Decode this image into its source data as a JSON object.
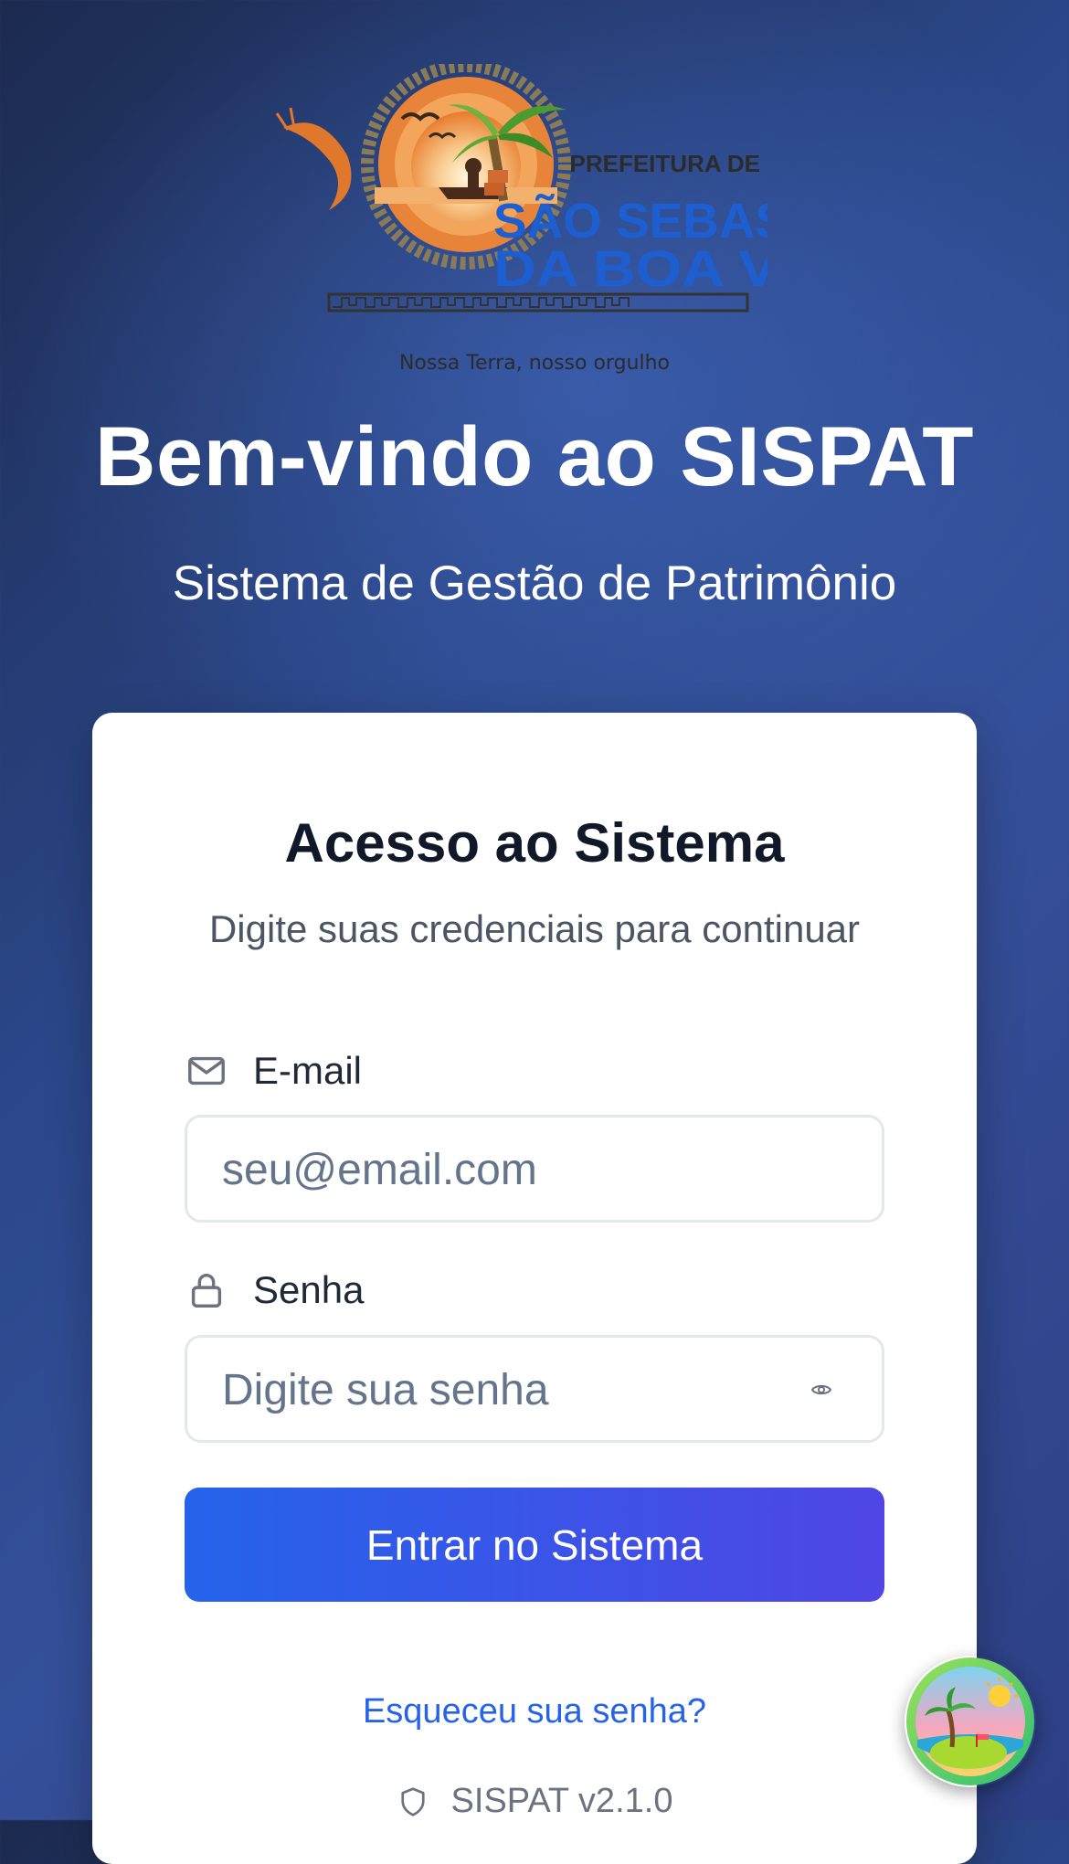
{
  "logo": {
    "line1": "PREFEITURA DE",
    "line2": "SÃO SEBASTIÃO",
    "line3": "DA BOA VISTA",
    "tagline": "Nossa Terra, nosso orgulho"
  },
  "hero": {
    "title": "Bem-vindo ao SISPAT",
    "subtitle": "Sistema de Gestão de Patrimônio"
  },
  "login": {
    "title": "Acesso ao Sistema",
    "subtitle": "Digite suas credenciais para continuar",
    "email": {
      "label": "E-mail",
      "placeholder": "seu@email.com",
      "value": ""
    },
    "password": {
      "label": "Senha",
      "placeholder": "Digite sua senha",
      "value": ""
    },
    "submit_label": "Entrar no Sistema",
    "forgot_label": "Esqueceu sua senha?",
    "version": "SISPAT v2.1.0"
  },
  "colors": {
    "accent": "#2563eb",
    "accent_end": "#4f46e5",
    "link": "#2563eb",
    "title_text": "#111827"
  },
  "icons": {
    "email": "mail-icon",
    "password": "lock-icon",
    "toggle_password": "eye-icon",
    "version": "shield-icon",
    "badge": "island-icon"
  }
}
